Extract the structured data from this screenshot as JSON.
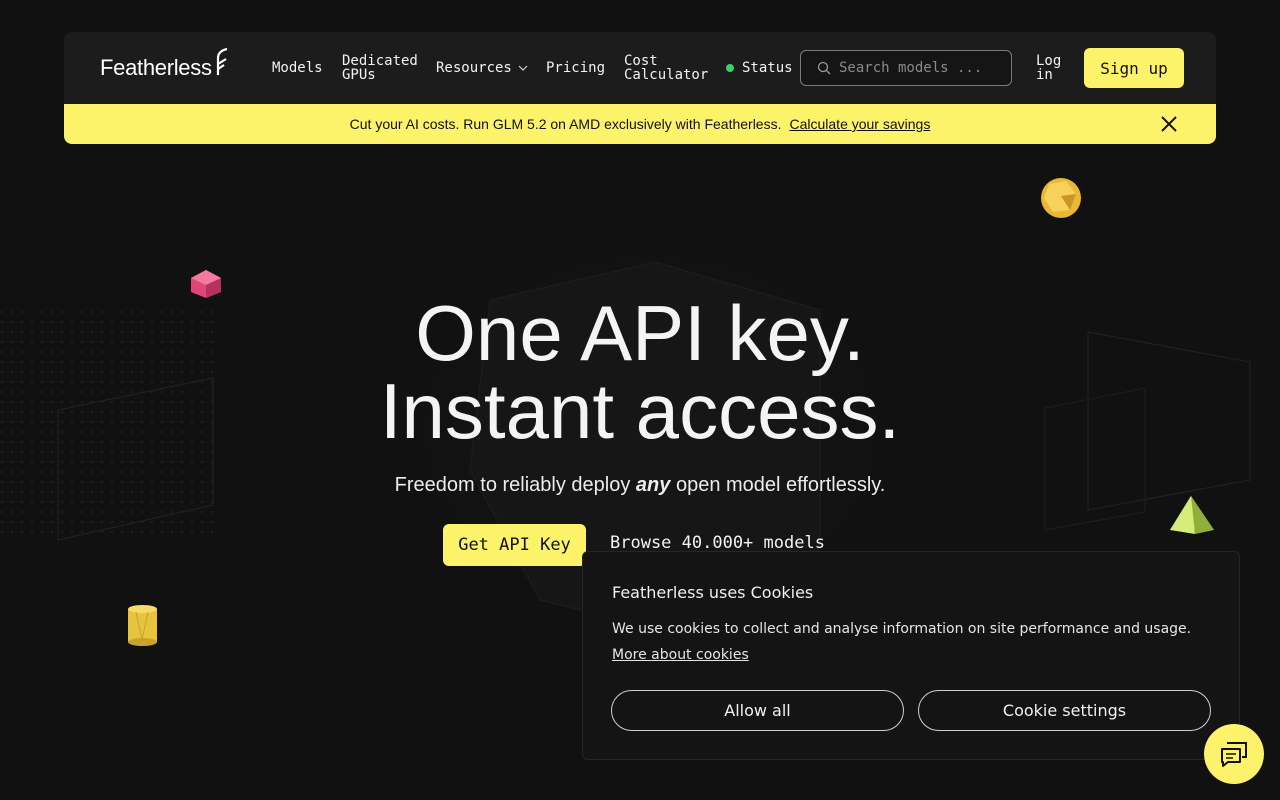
{
  "brand": {
    "name": "Featherless",
    "accent": "#fdf36b",
    "background": "#111111"
  },
  "nav": {
    "models": "Models",
    "dedicated_gpus": "Dedicated GPUs",
    "resources": "Resources",
    "pricing": "Pricing",
    "cost_calculator": "Cost Calculator",
    "status": "Status",
    "status_color": "#3ad16a",
    "search_placeholder": "Search models ...",
    "login": "Log in",
    "signup": "Sign up"
  },
  "banner": {
    "text": "Cut your AI costs. Run GLM 5.2 on AMD exclusively with Featherless.",
    "link": "Calculate your savings"
  },
  "hero": {
    "line1": "One API key.",
    "line2": "Instant access.",
    "sub_before": "Freedom to reliably deploy",
    "sub_emphasis": "any",
    "sub_after": "open model effortlessly.",
    "primary_cta": "Get API Key",
    "secondary_cta": "Browse 40.000+ models"
  },
  "cookie": {
    "title": "Featherless uses Cookies",
    "text": "We use cookies to collect and analyse information on site performance and usage.",
    "more": "More about cookies",
    "allow": "Allow all",
    "settings": "Cookie settings"
  },
  "icons": {
    "search": "search-icon",
    "chevron": "chevron-down-icon",
    "close": "close-icon",
    "chat": "chat-icon"
  }
}
